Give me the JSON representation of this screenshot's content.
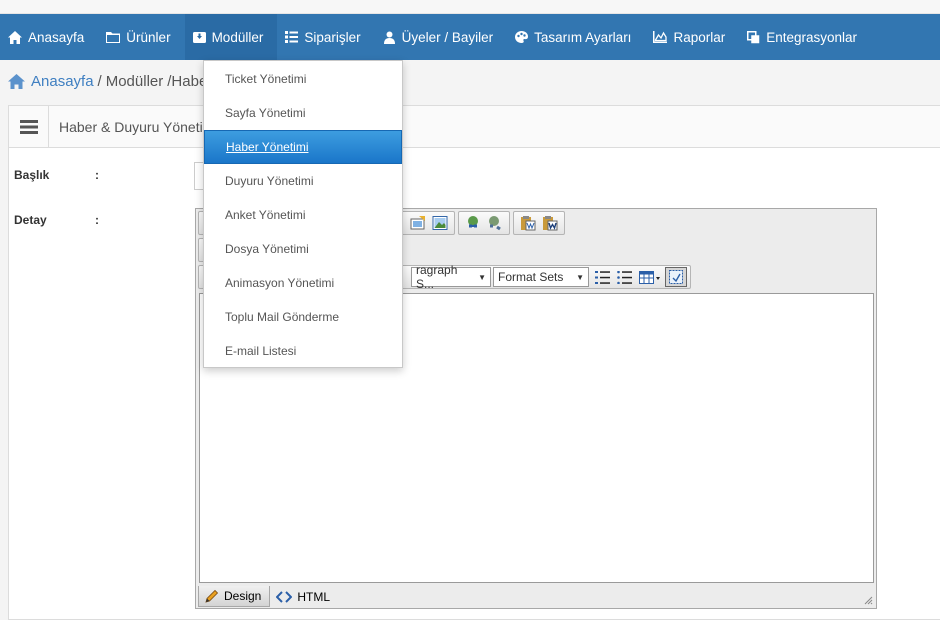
{
  "nav": {
    "items": [
      {
        "label": "Anasayfa",
        "icon": "home-icon"
      },
      {
        "label": "Ürünler",
        "icon": "folder-icon"
      },
      {
        "label": "Modüller",
        "icon": "inbox-icon"
      },
      {
        "label": "Siparişler",
        "icon": "list-icon"
      },
      {
        "label": "Üyeler / Bayiler",
        "icon": "user-icon"
      },
      {
        "label": "Tasarım Ayarları",
        "icon": "palette-icon"
      },
      {
        "label": "Raporlar",
        "icon": "chart-icon"
      },
      {
        "label": "Entegrasyonlar",
        "icon": "copy-icon"
      }
    ],
    "active_index": 2
  },
  "breadcrumb": {
    "home": "Anasayfa",
    "separator": "/",
    "modules": "Modüller",
    "current": "Haber"
  },
  "panel": {
    "title": "Haber & Duyuru Yöneti"
  },
  "form": {
    "title_label": "Başlık",
    "detail_label": "Detay",
    "colon": ":"
  },
  "editor": {
    "paragraph_select": "ragraph S...",
    "format_select": "Format Sets",
    "design_tab": "Design",
    "html_tab": "HTML"
  },
  "dropdown": {
    "items": [
      "Ticket Yönetimi",
      "Sayfa Yönetimi",
      "Haber Yönetimi",
      "Duyuru Yönetimi",
      "Anket Yönetimi",
      "Dosya Yönetimi",
      "Animasyon Yönetimi",
      "Toplu Mail Gönderme",
      "E-mail Listesi"
    ],
    "active_index": 2
  },
  "colors": {
    "nav_bg": "#3276b1",
    "link": "#3f7fc1",
    "menu_active": "#1a76c9"
  }
}
